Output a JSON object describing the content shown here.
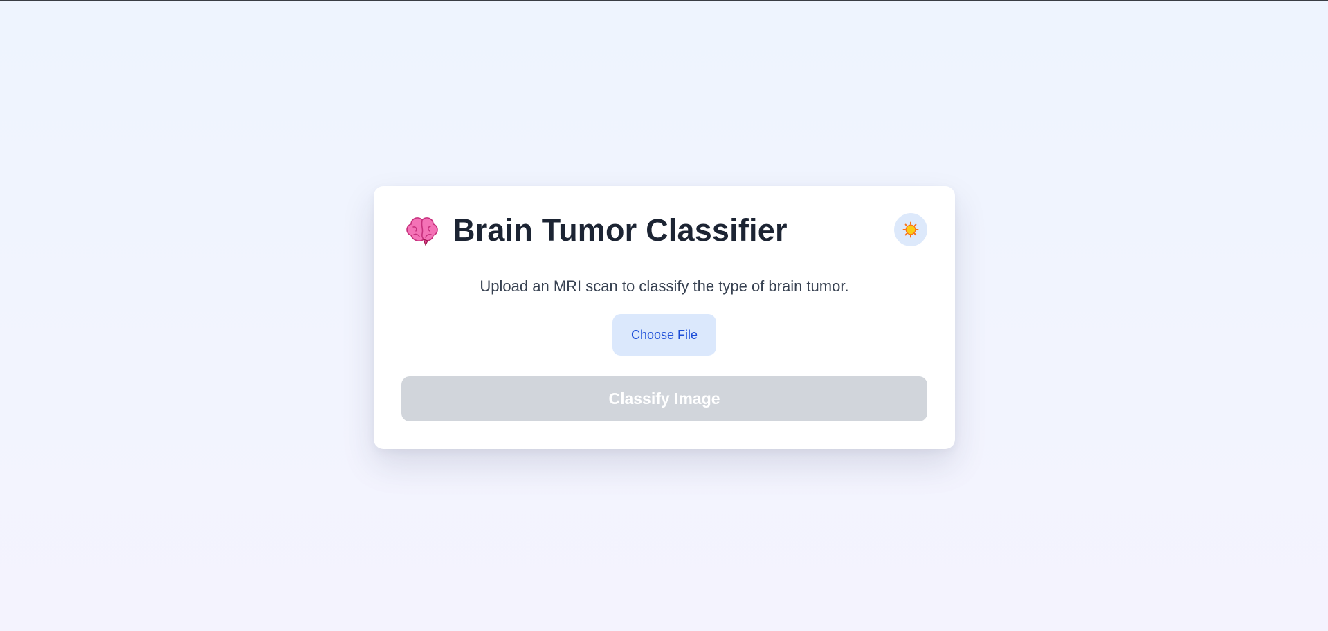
{
  "app": {
    "title": "Brain Tumor Classifier",
    "subtitle": "Upload an MRI scan to classify the type of brain tumor."
  },
  "icons": {
    "title_icon": "brain-icon",
    "theme_toggle_icon": "sun-icon"
  },
  "upload": {
    "choose_file_label": "Choose File"
  },
  "actions": {
    "classify_label": "Classify Image",
    "classify_enabled": false
  },
  "colors": {
    "accent_blue": "#1d4ed8",
    "choose_file_bg": "#dbe8fc",
    "classify_disabled_bg": "#d1d5db",
    "brain_pink": "#f472b6",
    "sun_yellow": "#facc15",
    "sun_rays": "#f97316"
  }
}
